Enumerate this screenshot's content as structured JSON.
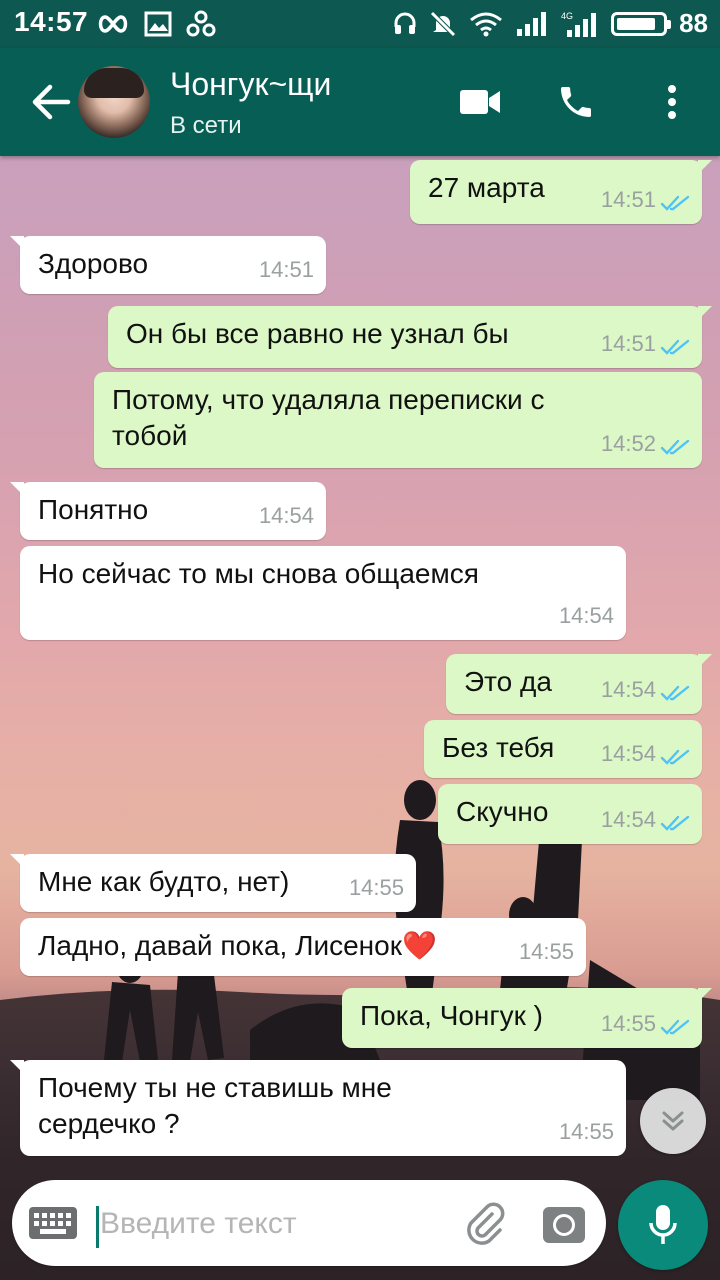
{
  "status_bar": {
    "time": "14:57",
    "battery": "88",
    "battery_level": 0.88,
    "network": "4G"
  },
  "header": {
    "contact_name": "Чонгук~щи",
    "status": "В сети"
  },
  "messages": [
    {
      "dir": "out",
      "text": "27 марта",
      "time": "14:51",
      "read": true
    },
    {
      "dir": "in",
      "text": "Здорово",
      "time": "14:51"
    },
    {
      "dir": "out",
      "text": "Он бы все равно не узнал бы",
      "time": "14:51",
      "read": true
    },
    {
      "dir": "out",
      "text": "Потому, что удаляла переписки с\nтобой",
      "time": "14:52",
      "read": true
    },
    {
      "dir": "in",
      "text": "Понятно",
      "time": "14:54"
    },
    {
      "dir": "in",
      "text": "Но сейчас то мы снова общаемся",
      "time": "14:54"
    },
    {
      "dir": "out",
      "text": "Это да",
      "time": "14:54",
      "read": true
    },
    {
      "dir": "out",
      "text": "Без тебя",
      "time": "14:54",
      "read": true
    },
    {
      "dir": "out",
      "text": "Скучно",
      "time": "14:54",
      "read": true
    },
    {
      "dir": "in",
      "text": "Мне как будто, нет)",
      "time": "14:55"
    },
    {
      "dir": "in",
      "text": "Ладно, давай пока, Лисенок❤️",
      "time": "14:55"
    },
    {
      "dir": "out",
      "text": "Пока, Чонгук )",
      "time": "14:55",
      "read": true
    },
    {
      "dir": "in",
      "text": "Почему ты не ставишь мне\nсердечко ?",
      "time": "14:55"
    }
  ],
  "input": {
    "placeholder": "Введите текст",
    "value": ""
  },
  "colors": {
    "header": "#075e54",
    "status_bar": "#0d5850",
    "outgoing": "#dcf8c6",
    "incoming": "#ffffff",
    "ticks": "#4fc3f7",
    "fab": "#0a8a7a"
  },
  "icons": [
    "back-arrow-icon",
    "video-call-icon",
    "phone-icon",
    "more-vert-icon",
    "double-check-icon",
    "scroll-down-icon",
    "keyboard-icon",
    "attach-icon",
    "camera-icon",
    "mic-icon"
  ]
}
